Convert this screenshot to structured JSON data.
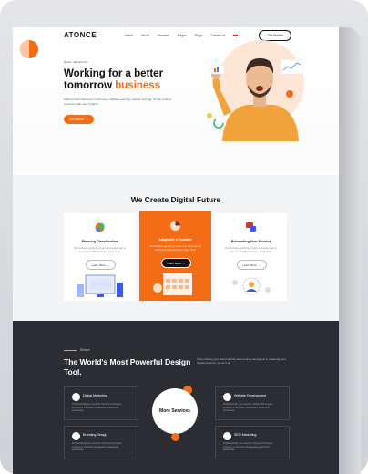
{
  "nav": {
    "logo": "ATONCE",
    "items": [
      "Home",
      "About",
      "Services",
      "Pages",
      "Blogs",
      "Contact us"
    ],
    "cta": "Get Started"
  },
  "hero": {
    "breadcrumb": "Home · Service Info",
    "title_line1": "Working for a better",
    "title_line2": "tomorrow",
    "title_accent": "business",
    "description": "Make product discovery continuous. Validate learning, capture and tag. Its day product decisions with user insights.",
    "button": "Get Started"
  },
  "future": {
    "title": "We Create Digital Future",
    "cards": [
      {
        "title": "Planning Classification",
        "description": "Pain includes gratifying of pain, and anger pain to sometimes fulfil pain lorem. Sorts of ds.",
        "button": "Learn More"
      },
      {
        "title": "Adaptable & Scalable",
        "description": "Pain includes gratifying of pain, and anger pain to sometimes fulfil pain lorem. Sorts of ds.",
        "button": "Learn More"
      },
      {
        "title": "Rebranding Your Product",
        "description": "Pain includes gratifying of pain, and anger pain to sometimes fulfil pain lorem. Sorts of ds.",
        "button": "Learn More"
      }
    ]
  },
  "services": {
    "label": "Service",
    "title": "The World's Most Powerful Design Tool.",
    "description": "If the refining your brand identity and running campaigns to powering your digital presence, we do it all.",
    "items": [
      {
        "name": "Digital Marketing",
        "description": "Professionally you network critical technologies, enhance a complete visualisation leadership, proactively."
      },
      {
        "name": "Website Development",
        "description": "Professionally you network critical technologies, enhance a complete visualisation leadership, proactively."
      },
      {
        "name": "Branding Design",
        "description": "Professionally you network critical technologies, enhance a complete visualisation leadership, proactively."
      },
      {
        "name": "SEO Marketing",
        "description": "Professionally you network critical technologies, enhance a complete visualisation leadership, proactively."
      }
    ],
    "more": "More Services"
  },
  "colors": {
    "accent": "#f36d16",
    "dark": "#2b2d33"
  }
}
